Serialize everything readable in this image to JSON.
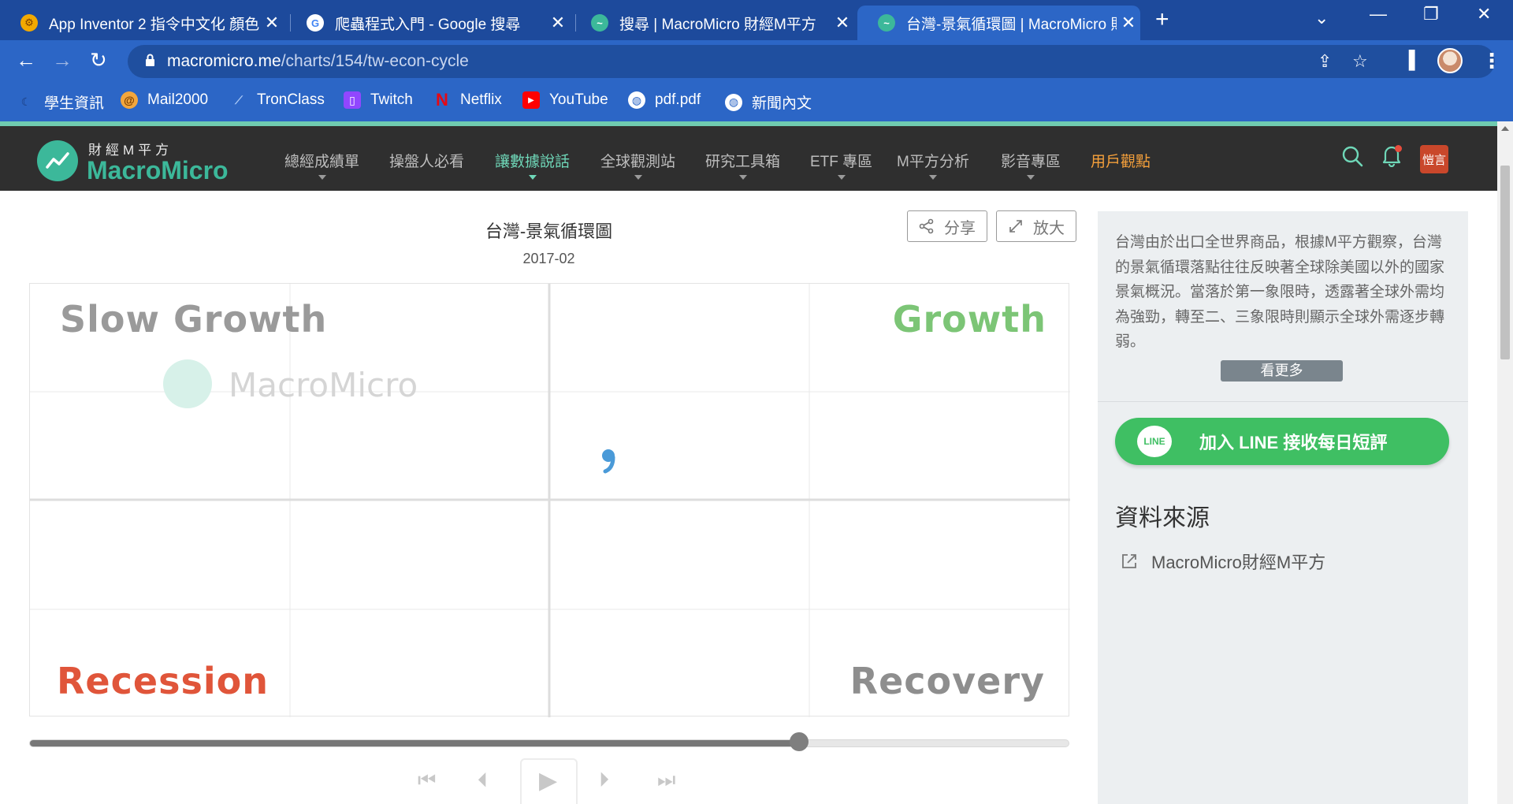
{
  "browser": {
    "tabs": [
      {
        "title": "App Inventor 2 指令中文化 顏色",
        "favicon": "app-inventor-icon",
        "active": false
      },
      {
        "title": "爬蟲程式入門 - Google 搜尋",
        "favicon": "google-icon",
        "active": false
      },
      {
        "title": "搜尋 | MacroMicro 財經M平方",
        "favicon": "macromicro-icon",
        "active": false
      },
      {
        "title": "台灣-景氣循環圖 | MacroMicro 財",
        "favicon": "macromicro-icon",
        "active": true
      }
    ],
    "url_host": "macromicro.me",
    "url_path": "/charts/154/tw-econ-cycle",
    "bookmarks": [
      {
        "label": "學生資訊",
        "icon": "moon-icon"
      },
      {
        "label": "Mail2000",
        "icon": "mail-icon"
      },
      {
        "label": "TronClass",
        "icon": "tronclass-icon"
      },
      {
        "label": "Twitch",
        "icon": "twitch-icon"
      },
      {
        "label": "Netflix",
        "icon": "netflix-icon"
      },
      {
        "label": "YouTube",
        "icon": "youtube-icon"
      },
      {
        "label": "pdf.pdf",
        "icon": "globe-icon"
      },
      {
        "label": "新聞內文",
        "icon": "globe-icon"
      }
    ]
  },
  "site": {
    "logo_cn": "財經M平方",
    "logo_en": "MacroMicro",
    "menu": [
      {
        "label": "總經成績單",
        "has_caret": true,
        "state": "normal"
      },
      {
        "label": "操盤人必看",
        "has_caret": false,
        "state": "normal"
      },
      {
        "label": "讓數據說話",
        "has_caret": true,
        "state": "selected"
      },
      {
        "label": "全球觀測站",
        "has_caret": true,
        "state": "normal"
      },
      {
        "label": "研究工具箱",
        "has_caret": true,
        "state": "normal"
      },
      {
        "label": "ETF 專區",
        "has_caret": true,
        "state": "normal"
      },
      {
        "label": "M平方分析",
        "has_caret": true,
        "state": "normal"
      },
      {
        "label": "影音專區",
        "has_caret": true,
        "state": "normal"
      },
      {
        "label": "用戶觀點",
        "has_caret": false,
        "state": "highlight"
      }
    ],
    "user_badge": "愷言",
    "accent_color": "#3cb89a"
  },
  "chart": {
    "title": "台灣-景氣循環圖",
    "date": "2017-02",
    "share_label": "分享",
    "zoom_label": "放大",
    "quadrants": {
      "top_left": "Slow Growth",
      "top_right": "Growth",
      "bottom_left": "Recession",
      "bottom_right": "Recovery"
    },
    "watermark": "MacroMicro",
    "timeline_progress": 0.74
  },
  "sidebar": {
    "description": "台灣由於出口全世界商品，根據M平方觀察，台灣的景氣循環落點往往反映著全球除美國以外的國家景氣概況。當落於第一象限時，透露著全球外需均為強勁，轉至二、三象限時則顯示全球外需逐步轉弱。",
    "more_label": "看更多",
    "line_button": "加入 LINE 接收每日短評",
    "line_icon_text": "LINE",
    "source_title": "資料來源",
    "source_link": "MacroMicro財經M平方"
  }
}
